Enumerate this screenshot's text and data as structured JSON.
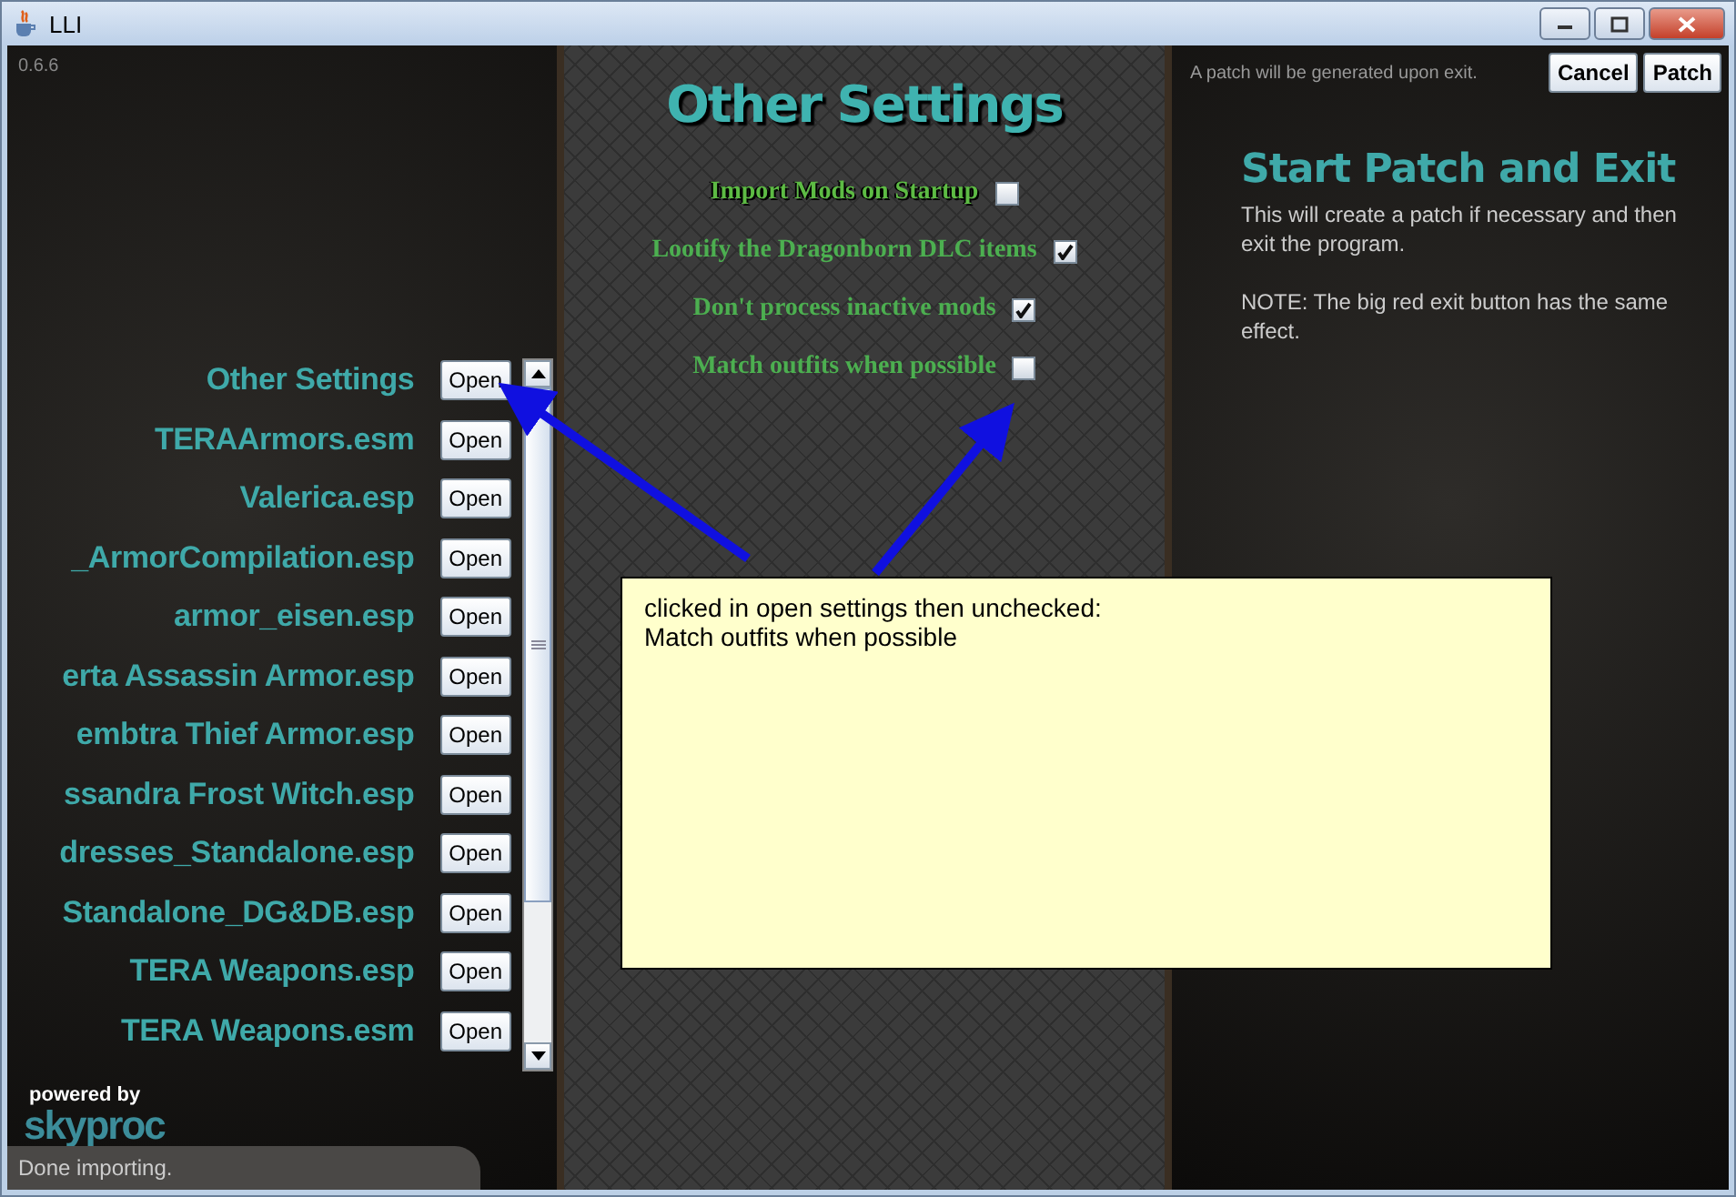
{
  "window": {
    "title": "LLI"
  },
  "version": "0.6.6",
  "mod_list": {
    "items": [
      {
        "label": "Other Settings",
        "button": "Open"
      },
      {
        "label": "TERAArmors.esm",
        "button": "Open"
      },
      {
        "label": "Valerica.esp",
        "button": "Open"
      },
      {
        "label": "_ArmorCompilation.esp",
        "button": "Open"
      },
      {
        "label": "armor_eisen.esp",
        "button": "Open"
      },
      {
        "label": "erta Assassin Armor.esp",
        "button": "Open"
      },
      {
        "label": "embtra Thief Armor.esp",
        "button": "Open"
      },
      {
        "label": "ssandra Frost Witch.esp",
        "button": "Open"
      },
      {
        "label": "dresses_Standalone.esp",
        "button": "Open"
      },
      {
        "label": "Standalone_DG&DB.esp",
        "button": "Open"
      },
      {
        "label": "TERA Weapons.esp",
        "button": "Open"
      },
      {
        "label": "TERA Weapons.esm",
        "button": "Open"
      }
    ]
  },
  "logo": {
    "tagline": "powered by",
    "name": "skyproc"
  },
  "status_bar": "Done importing.",
  "settings": {
    "title": "Other Settings",
    "options": [
      {
        "label": "Import Mods on Startup",
        "checked": false,
        "selected": true
      },
      {
        "label": "Lootify the Dragonborn DLC items",
        "checked": true,
        "selected": false
      },
      {
        "label": "Don't process inactive mods",
        "checked": true,
        "selected": false
      },
      {
        "label": "Match outfits when possible",
        "checked": false,
        "selected": false
      }
    ]
  },
  "right_panel": {
    "notice": "A patch will be generated upon exit.",
    "buttons": [
      "Cancel",
      "Patch"
    ],
    "heading": "Start Patch and Exit",
    "paragraphs": [
      "This will create a patch if necessary and then exit the program.",
      "NOTE: The big red exit button has the same effect."
    ]
  },
  "annotation": {
    "lines": [
      "clicked in open settings then unchecked:",
      "Match outfits when possible"
    ]
  }
}
